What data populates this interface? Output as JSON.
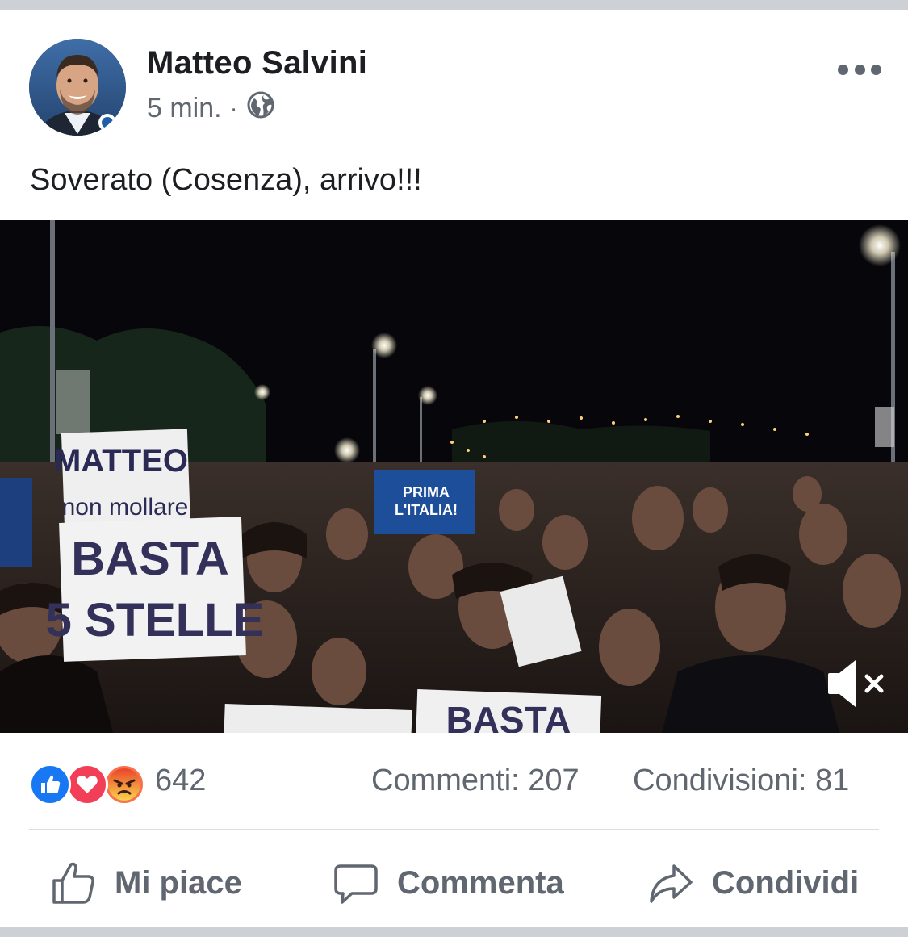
{
  "post": {
    "author": "Matteo Salvini",
    "time": "5 min.",
    "separator": "·",
    "privacy_icon": "globe-icon",
    "text": "Soverato (Cosenza), arrivo!!!"
  },
  "video": {
    "signs": {
      "sign1_line1": "MATTEO",
      "sign1_line2": "non mollare",
      "sign2_line1": "BASTA",
      "sign2_line2": "5 STELLE",
      "banner_line1": "PRIMA",
      "banner_line2": "L'ITALIA!",
      "sign3": "BASTA"
    },
    "mute_icon": "speaker-muted-icon"
  },
  "stats": {
    "reactions": [
      "like",
      "love",
      "angry"
    ],
    "reaction_count": "642",
    "comments": "Commenti: 207",
    "shares": "Condivisioni: 81"
  },
  "actions": {
    "like": "Mi piace",
    "comment": "Commenta",
    "share": "Condividi"
  },
  "colors": {
    "like_blue": "#1877f2",
    "love_red": "#f33e58",
    "angry_orange": "#f7714c",
    "meta_gray": "#606770"
  }
}
